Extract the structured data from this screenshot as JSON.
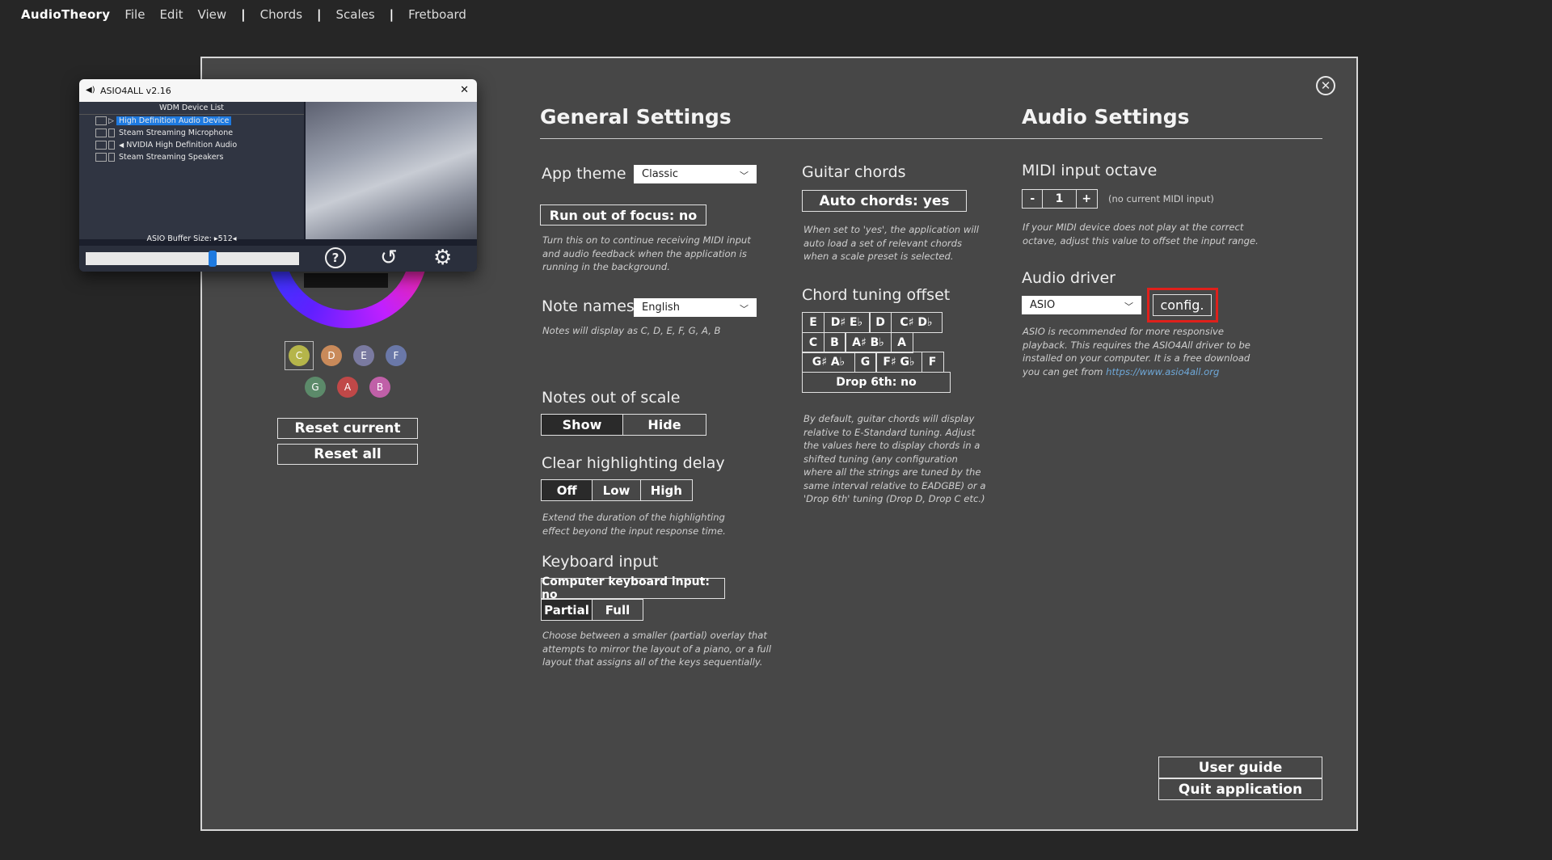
{
  "menubar": {
    "brand": "AudioTheory",
    "file": "File",
    "edit": "Edit",
    "view": "View",
    "chords": "Chords",
    "scales": "Scales",
    "fretboard": "Fretboard",
    "separator": "|"
  },
  "general": {
    "heading": "General Settings",
    "app_theme": {
      "label": "App theme",
      "value": "Classic"
    },
    "focus": {
      "button": "Run out of focus: no",
      "desc": "Turn this on to continue receiving MIDI input and audio feedback when the application is running in the background."
    },
    "note_names": {
      "label": "Note names",
      "value": "English",
      "desc": "Notes will display as C, D, E, F, G, A, B"
    },
    "notes_out": {
      "label": "Notes out of scale",
      "options": [
        "Show",
        "Hide"
      ],
      "selected": "Show"
    },
    "clear_delay": {
      "label": "Clear highlighting delay",
      "options": [
        "Off",
        "Low",
        "High"
      ],
      "selected": "Off",
      "desc": "Extend the duration of the highlighting effect beyond the input response time."
    },
    "keyboard": {
      "label": "Keyboard input",
      "button": "Computer keyboard input: no",
      "options": [
        "Partial",
        "Full"
      ],
      "selected": "Partial",
      "desc": "Choose between a smaller (partial) overlay that attempts to mirror the layout of a piano, or a full layout that assigns all of the keys sequentially."
    }
  },
  "guitar": {
    "label": "Guitar chords",
    "button": "Auto chords: yes",
    "desc": "When set to 'yes', the application will auto load a set of relevant chords when a scale preset is selected.",
    "tuning_label": "Chord tuning offset",
    "tuning_rows": [
      [
        "E",
        "D♯ E♭",
        "D",
        "C♯ D♭"
      ],
      [
        "C",
        "B",
        "A♯ B♭",
        "A"
      ],
      [
        "G♯ A♭",
        "G",
        "F♯ G♭",
        "F"
      ]
    ],
    "drop": "Drop 6th: no",
    "tuning_desc": "By default, guitar chords will display relative to E-Standard tuning. Adjust the values here to display chords in a shifted tuning (any configuration where all the strings are tuned by the same interval relative to EADGBE) or a 'Drop 6th' tuning (Drop D, Drop C etc.)"
  },
  "audio": {
    "heading": "Audio Settings",
    "midi_label": "MIDI input octave",
    "minus": "-",
    "octave": "1",
    "plus": "+",
    "midi_status": "(no current MIDI input)",
    "midi_desc": "If your MIDI device does not play at the correct octave, adjust this value to offset the input range.",
    "driver_label": "Audio driver",
    "driver_value": "ASIO",
    "config_button": "config.",
    "driver_desc": "ASIO is recommended for more responsive playback. This requires the ASIO4All driver to be installed on your computer. It is a free download you can get from",
    "driver_link": "https://www.asio4all.org",
    "highlight_color": "#e0201b"
  },
  "bottom": {
    "user_guide": "User guide",
    "quit": "Quit application"
  },
  "left": {
    "notes": [
      "C",
      "D",
      "E",
      "F",
      "G",
      "A",
      "B"
    ],
    "note_colors": [
      "#b5b54a",
      "#c98a5a",
      "#7a7aa0",
      "#6a78a8",
      "#5c8a6a",
      "#c04848",
      "#c060a8"
    ],
    "reset_current": "Reset current",
    "reset_all": "Reset all"
  },
  "asio": {
    "title": "ASIO4ALL v2.16",
    "close": "✕",
    "list_header": "WDM Device List",
    "devices": [
      "High Definition Audio Device",
      "Steam Streaming Microphone",
      "NVIDIA High Definition Audio",
      "Steam Streaming Speakers"
    ],
    "buffer_label": "ASIO Buffer Size: ▸512◂",
    "buffer_fraction": 0.6
  },
  "close_icon": "✕"
}
